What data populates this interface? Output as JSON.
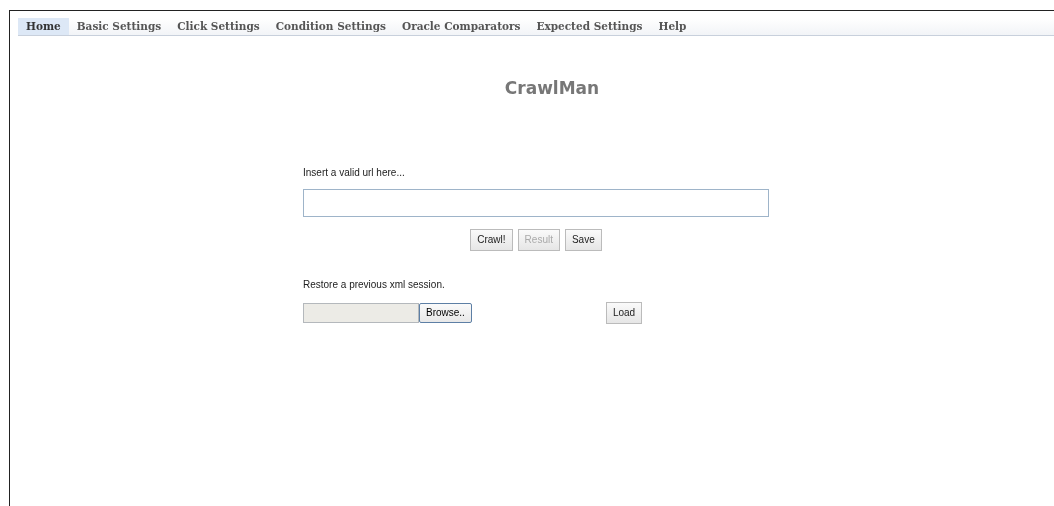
{
  "tabs": [
    {
      "label": "Home",
      "selected": true
    },
    {
      "label": "Basic Settings",
      "selected": false
    },
    {
      "label": "Click Settings",
      "selected": false
    },
    {
      "label": "Condition Settings",
      "selected": false
    },
    {
      "label": "Oracle Comparators",
      "selected": false
    },
    {
      "label": "Expected Settings",
      "selected": false
    },
    {
      "label": "Help",
      "selected": false
    }
  ],
  "title": "CrawlMan",
  "url_label": "Insert a valid url here...",
  "actions": [
    {
      "label": "Crawl!",
      "disabled": false
    },
    {
      "label": "Result",
      "disabled": true
    },
    {
      "label": "Save",
      "disabled": false
    }
  ],
  "restore_label": "Restore a previous xml session.",
  "browse_button": "Browse..",
  "load_button": "Load"
}
